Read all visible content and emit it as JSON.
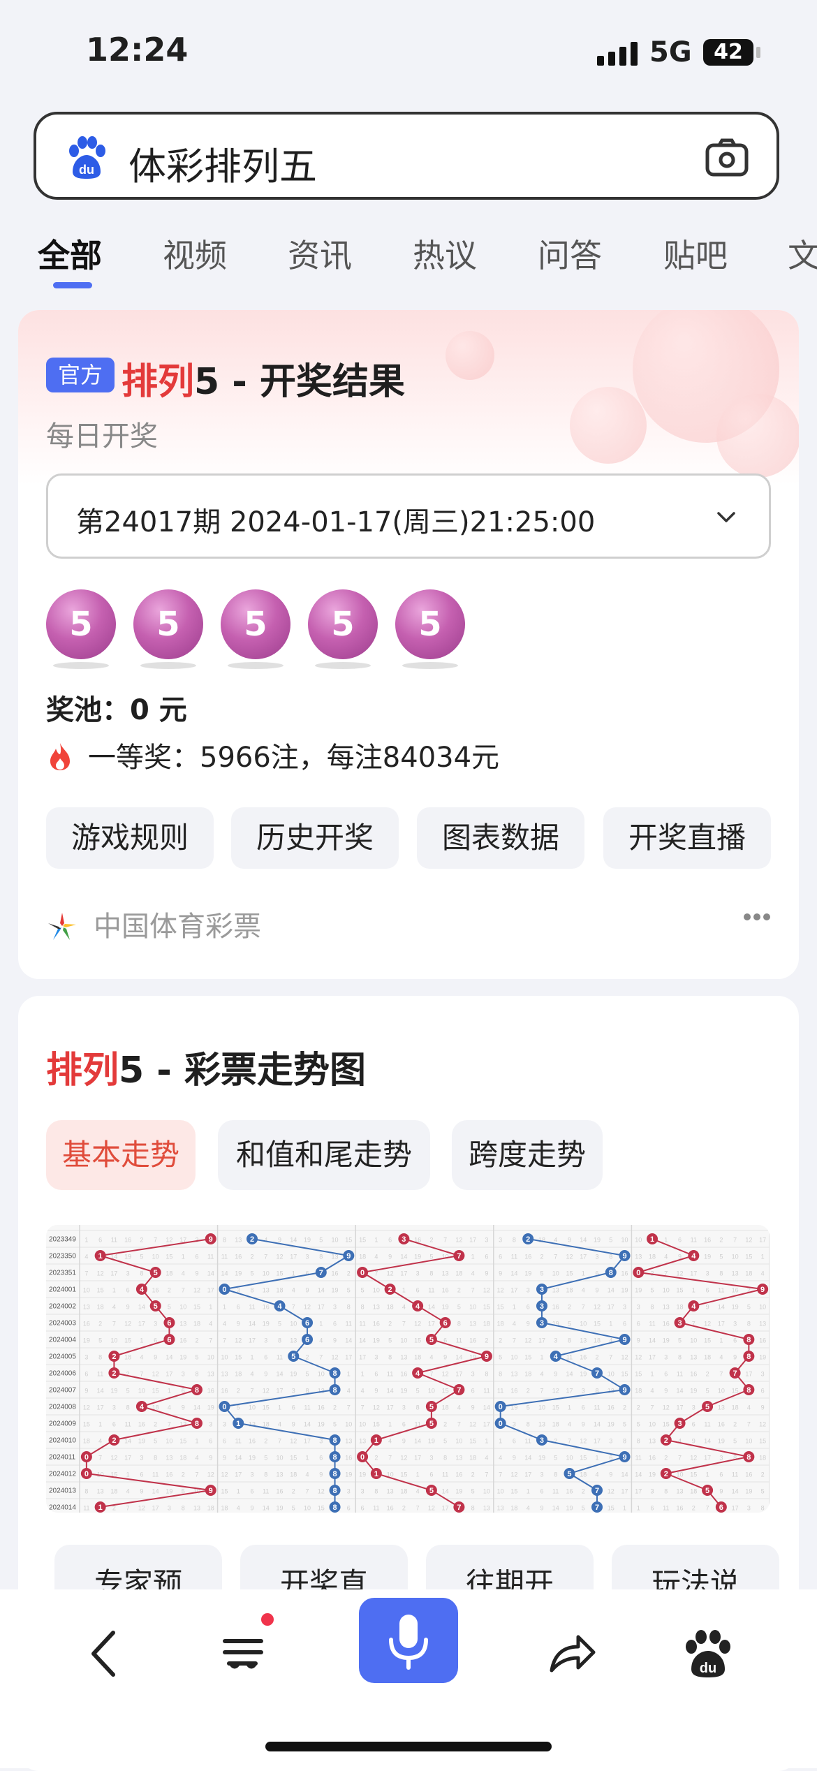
{
  "status_bar": {
    "time": "12:24",
    "network": "5G",
    "battery": "42"
  },
  "search": {
    "query": "体彩排列五"
  },
  "tabs": [
    {
      "label": "全部",
      "active": true
    },
    {
      "label": "视频"
    },
    {
      "label": "资讯"
    },
    {
      "label": "热议"
    },
    {
      "label": "问答"
    },
    {
      "label": "贴吧"
    },
    {
      "label": "文"
    }
  ],
  "result_card": {
    "badge": "官方",
    "title_red": "排列",
    "title_rest": "5 - 开奖结果",
    "subtitle": "每日开奖",
    "period": "第24017期 2024-01-17(周三)21:25:00",
    "numbers": [
      "5",
      "5",
      "5",
      "5",
      "5"
    ],
    "pool": "奖池：0 元",
    "prize": "一等奖：5966注，每注84034元",
    "buttons": [
      "游戏规则",
      "历史开奖",
      "图表数据",
      "开奖直播"
    ],
    "source": "中国体育彩票"
  },
  "trend_card": {
    "title_red": "排列",
    "title_rest": "5 - 彩票走势图",
    "tabs": [
      {
        "label": "基本走势",
        "active": true
      },
      {
        "label": "和值和尾走势"
      },
      {
        "label": "跨度走势"
      }
    ],
    "more_buttons": [
      "专家预",
      "开奖直",
      "往期开",
      "玩法说"
    ],
    "chart_data": {
      "type": "line",
      "periods": [
        "2023349",
        "2023350",
        "2023351",
        "2024001",
        "2024002",
        "2024003",
        "2024004",
        "2024005",
        "2024006",
        "2024007",
        "2024008",
        "2024009",
        "2024010",
        "2024011",
        "2024012",
        "2024013",
        "2024014"
      ],
      "series": [
        {
          "color": "#c0324a",
          "values": [
            9,
            1,
            5,
            4,
            5,
            6,
            6,
            2,
            2,
            8,
            4,
            8,
            2,
            0,
            0,
            9,
            1
          ]
        },
        {
          "color": "#3d6fb5",
          "values": [
            2,
            9,
            7,
            0,
            4,
            6,
            6,
            5,
            8,
            8,
            0,
            1,
            8,
            8,
            8,
            8,
            8
          ]
        },
        {
          "color": "#c0324a",
          "values": [
            3,
            7,
            0,
            2,
            4,
            6,
            5,
            9,
            4,
            7,
            5,
            5,
            1,
            0,
            1,
            5,
            7
          ]
        },
        {
          "color": "#3d6fb5",
          "values": [
            2,
            9,
            8,
            3,
            3,
            3,
            9,
            4,
            7,
            9,
            0,
            0,
            3,
            9,
            5,
            7,
            7
          ]
        },
        {
          "color": "#c0324a",
          "values": [
            1,
            4,
            0,
            9,
            4,
            3,
            8,
            8,
            7,
            8,
            5,
            3,
            2,
            8,
            2,
            5,
            6
          ]
        }
      ]
    }
  },
  "bottom_bar": {
    "icons": [
      "back-icon",
      "tabs-icon",
      "mic-icon",
      "share-icon",
      "baidu-paw-icon"
    ]
  }
}
